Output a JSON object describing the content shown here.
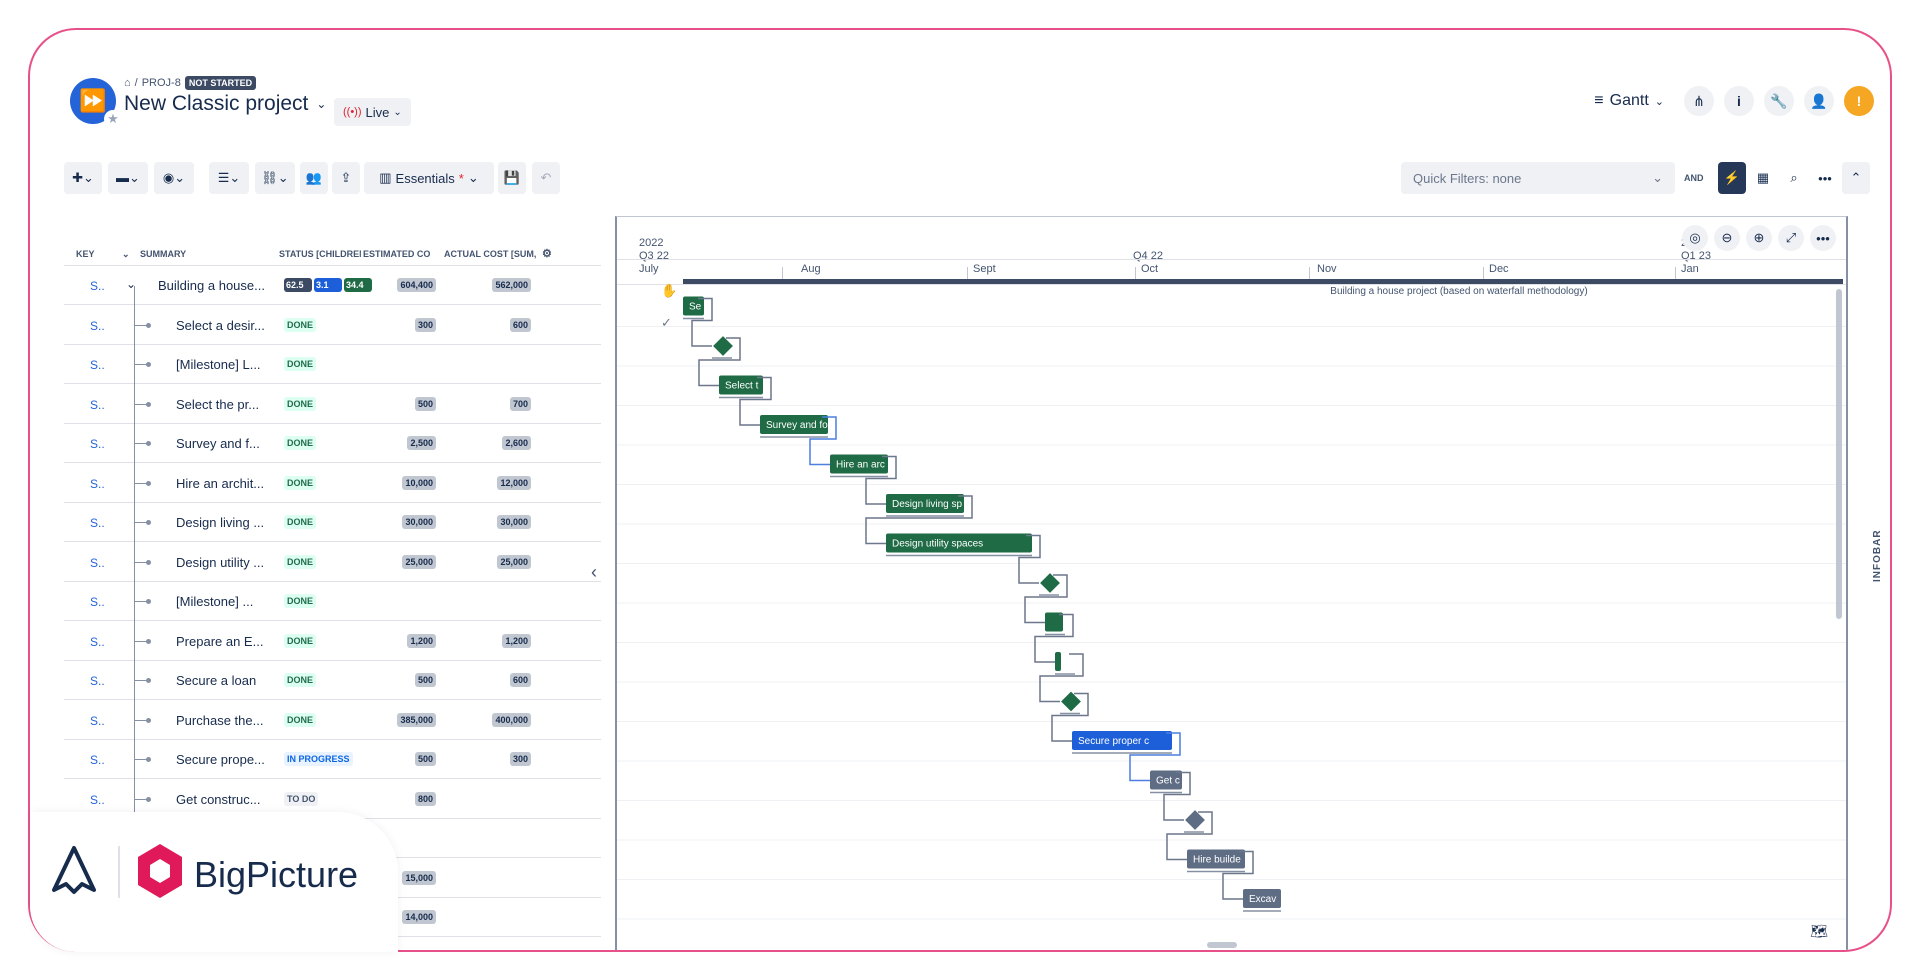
{
  "breadcrumb": {
    "home_icon": "home-icon",
    "separator": "/",
    "project_key": "PROJ-8",
    "status_badge": "NOT STARTED"
  },
  "page_title": "New Classic project",
  "live_button": "Live",
  "header_right": {
    "view_label": "Gantt"
  },
  "toolbar": {
    "essentials_label": "Essentials",
    "essentials_mark": "*",
    "quick_filter": "Quick Filters: none",
    "and_label": "AND"
  },
  "grid": {
    "columns": [
      "KEY",
      "SUMMARY",
      "STATUS [CHILDREN S",
      "ESTIMATED CO",
      "ACTUAL COST [SUM, ’"
    ],
    "rows": [
      {
        "key": "S..",
        "summary": "Building a house...",
        "status": "",
        "est": "604,400",
        "act": "562,000",
        "parent": true
      },
      {
        "key": "S..",
        "summary": "Select a desir...",
        "status": "DONE",
        "est": "300",
        "act": "600"
      },
      {
        "key": "S..",
        "summary": "[Milestone] L...",
        "status": "DONE",
        "est": "",
        "act": ""
      },
      {
        "key": "S..",
        "summary": "Select the pr...",
        "status": "DONE",
        "est": "500",
        "act": "700"
      },
      {
        "key": "S..",
        "summary": "Survey and f...",
        "status": "DONE",
        "est": "2,500",
        "act": "2,600"
      },
      {
        "key": "S..",
        "summary": "Hire an archit...",
        "status": "DONE",
        "est": "10,000",
        "act": "12,000"
      },
      {
        "key": "S..",
        "summary": "Design living ...",
        "status": "DONE",
        "est": "30,000",
        "act": "30,000"
      },
      {
        "key": "S..",
        "summary": "Design utility ...",
        "status": "DONE",
        "est": "25,000",
        "act": "25,000"
      },
      {
        "key": "S..",
        "summary": "[Milestone] ...",
        "status": "DONE",
        "est": "",
        "act": ""
      },
      {
        "key": "S..",
        "summary": "Prepare an E...",
        "status": "DONE",
        "est": "1,200",
        "act": "1,200"
      },
      {
        "key": "S..",
        "summary": "Secure a loan",
        "status": "DONE",
        "est": "500",
        "act": "600"
      },
      {
        "key": "S..",
        "summary": "Purchase the...",
        "status": "DONE",
        "est": "385,000",
        "act": "400,000"
      },
      {
        "key": "S..",
        "summary": "Secure prope...",
        "status": "IN PROGRESS",
        "est": "500",
        "act": "300"
      },
      {
        "key": "S..",
        "summary": "Get construc...",
        "status": "TO DO",
        "est": "800",
        "act": ""
      },
      {
        "key": "",
        "summary": "",
        "status": "",
        "est": "",
        "act": ""
      },
      {
        "key": "",
        "summary": "",
        "status": "",
        "est": "15,000",
        "act": ""
      },
      {
        "key": "",
        "summary": "",
        "status": "",
        "est": "14,000",
        "act": ""
      }
    ],
    "parent_progress": [
      "62.5",
      "3.1",
      "34.4"
    ]
  },
  "timeline": {
    "year1": "2022",
    "q1": "Q3 22",
    "q2": "Q4 22",
    "year2": "2(",
    "q3": "Q1 23",
    "months": [
      "July",
      "Aug",
      "Sept",
      "Oct",
      "Nov",
      "Dec",
      "Jan"
    ]
  },
  "gantt": {
    "summary_label": "Building a house project (based on waterfall methodology)",
    "bars": [
      {
        "label": "Se",
        "color": "green"
      },
      {
        "label": "",
        "color": "green",
        "milestone": true
      },
      {
        "label": "Select t",
        "color": "green"
      },
      {
        "label": "Survey and fo",
        "color": "green"
      },
      {
        "label": "Hire an arc",
        "color": "green"
      },
      {
        "label": "Design living sp",
        "color": "green"
      },
      {
        "label": "Design utility spaces",
        "color": "green"
      },
      {
        "label": "",
        "color": "green",
        "milestone": true
      },
      {
        "label": "",
        "color": "green"
      },
      {
        "label": "",
        "color": "green"
      },
      {
        "label": "",
        "color": "green",
        "milestone": true
      },
      {
        "label": "Secure proper c",
        "color": "blue"
      },
      {
        "label": "Get c",
        "color": "gray"
      },
      {
        "label": "",
        "color": "gray",
        "milestone": true
      },
      {
        "label": "Hire builde",
        "color": "gray"
      },
      {
        "label": "Excav",
        "color": "gray"
      }
    ]
  },
  "infobar_label": "INFOBAR",
  "branding": {
    "name": "BigPicture"
  },
  "colors": {
    "green": "#1f6b45",
    "blue": "#1d5fd8",
    "gray": "#5e6c84",
    "accent_pink": "#e8508a"
  }
}
